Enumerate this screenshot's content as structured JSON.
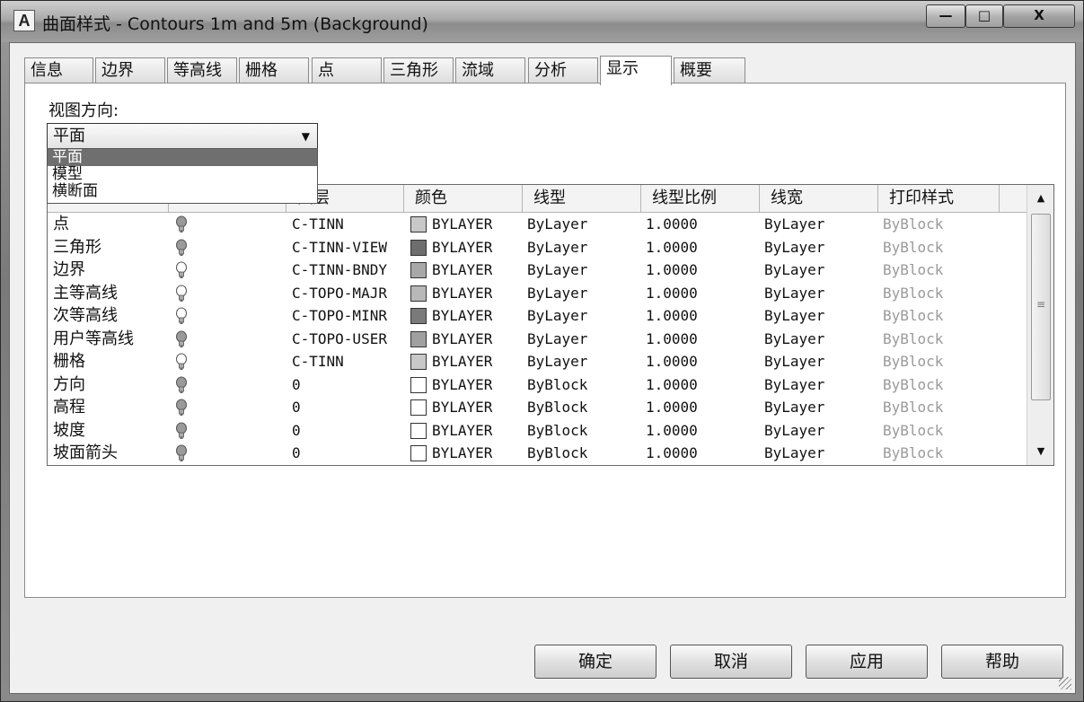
{
  "window": {
    "title": "曲面样式 - Contours 1m and 5m (Background)",
    "app_icon": "A",
    "minimize_glyph": "—",
    "maximize_glyph": "□",
    "close_glyph": "X"
  },
  "tabs": [
    "信息",
    "边界",
    "等高线",
    "栅格",
    "点",
    "三角形",
    "流域",
    "分析",
    "显示",
    "概要"
  ],
  "active_tab": "显示",
  "view_direction": {
    "label": "视图方向:",
    "selected": "平面",
    "options": [
      "平面",
      "模型",
      "横断面"
    ]
  },
  "table": {
    "headers": [
      "",
      "",
      "图层",
      "颜色",
      "线型",
      "线型比例",
      "线宽",
      "打印样式"
    ],
    "rows": [
      {
        "name": "点",
        "layer": "C-TINN",
        "color": "BYLAYER",
        "linetype": "ByLayer",
        "scale": "1.0000",
        "lineweight": "ByLayer",
        "plotstyle": "ByBlock",
        "swatch": "#c8c8c8",
        "bulb_on": true
      },
      {
        "name": "三角形",
        "layer": "C-TINN-VIEW",
        "color": "BYLAYER",
        "linetype": "ByLayer",
        "scale": "1.0000",
        "lineweight": "ByLayer",
        "plotstyle": "ByBlock",
        "swatch": "#6e6e6e",
        "bulb_on": true
      },
      {
        "name": "边界",
        "layer": "C-TINN-BNDY",
        "color": "BYLAYER",
        "linetype": "ByLayer",
        "scale": "1.0000",
        "lineweight": "ByLayer",
        "plotstyle": "ByBlock",
        "swatch": "#a8a8a8",
        "bulb_on": false
      },
      {
        "name": "主等高线",
        "layer": "C-TOPO-MAJR",
        "color": "BYLAYER",
        "linetype": "ByLayer",
        "scale": "1.0000",
        "lineweight": "ByLayer",
        "plotstyle": "ByBlock",
        "swatch": "#b8b8b8",
        "bulb_on": false
      },
      {
        "name": "次等高线",
        "layer": "C-TOPO-MINR",
        "color": "BYLAYER",
        "linetype": "ByLayer",
        "scale": "1.0000",
        "lineweight": "ByLayer",
        "plotstyle": "ByBlock",
        "swatch": "#7a7a7a",
        "bulb_on": false
      },
      {
        "name": "用户等高线",
        "layer": "C-TOPO-USER",
        "color": "BYLAYER",
        "linetype": "ByLayer",
        "scale": "1.0000",
        "lineweight": "ByLayer",
        "plotstyle": "ByBlock",
        "swatch": "#a0a0a0",
        "bulb_on": true
      },
      {
        "name": "栅格",
        "layer": "C-TINN",
        "color": "BYLAYER",
        "linetype": "ByLayer",
        "scale": "1.0000",
        "lineweight": "ByLayer",
        "plotstyle": "ByBlock",
        "swatch": "#c8c8c8",
        "bulb_on": false
      },
      {
        "name": "方向",
        "layer": "0",
        "color": "BYLAYER",
        "linetype": "ByBlock",
        "scale": "1.0000",
        "lineweight": "ByLayer",
        "plotstyle": "ByBlock",
        "swatch": "#ffffff",
        "bulb_on": true
      },
      {
        "name": "高程",
        "layer": "0",
        "color": "BYLAYER",
        "linetype": "ByBlock",
        "scale": "1.0000",
        "lineweight": "ByLayer",
        "plotstyle": "ByBlock",
        "swatch": "#ffffff",
        "bulb_on": true
      },
      {
        "name": "坡度",
        "layer": "0",
        "color": "BYLAYER",
        "linetype": "ByBlock",
        "scale": "1.0000",
        "lineweight": "ByLayer",
        "plotstyle": "ByBlock",
        "swatch": "#ffffff",
        "bulb_on": true
      },
      {
        "name": "坡面箭头",
        "layer": "0",
        "color": "BYLAYER",
        "linetype": "ByBlock",
        "scale": "1.0000",
        "lineweight": "ByLayer",
        "plotstyle": "ByBlock",
        "swatch": "#ffffff",
        "bulb_on": true
      }
    ]
  },
  "buttons": {
    "ok": "确定",
    "cancel": "取消",
    "apply": "应用",
    "help": "帮助"
  }
}
